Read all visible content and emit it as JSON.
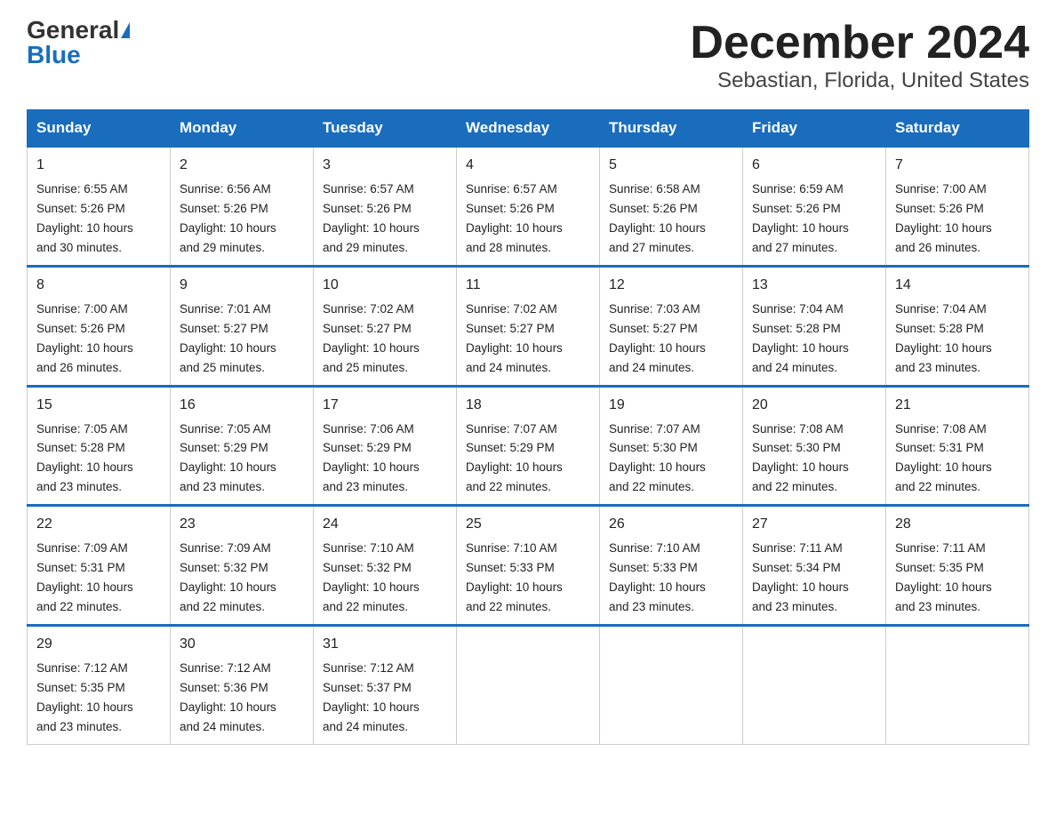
{
  "logo": {
    "general": "General",
    "blue": "Blue"
  },
  "title": "December 2024",
  "subtitle": "Sebastian, Florida, United States",
  "days_of_week": [
    "Sunday",
    "Monday",
    "Tuesday",
    "Wednesday",
    "Thursday",
    "Friday",
    "Saturday"
  ],
  "weeks": [
    [
      {
        "num": "1",
        "sunrise": "6:55 AM",
        "sunset": "5:26 PM",
        "daylight": "10 hours and 30 minutes."
      },
      {
        "num": "2",
        "sunrise": "6:56 AM",
        "sunset": "5:26 PM",
        "daylight": "10 hours and 29 minutes."
      },
      {
        "num": "3",
        "sunrise": "6:57 AM",
        "sunset": "5:26 PM",
        "daylight": "10 hours and 29 minutes."
      },
      {
        "num": "4",
        "sunrise": "6:57 AM",
        "sunset": "5:26 PM",
        "daylight": "10 hours and 28 minutes."
      },
      {
        "num": "5",
        "sunrise": "6:58 AM",
        "sunset": "5:26 PM",
        "daylight": "10 hours and 27 minutes."
      },
      {
        "num": "6",
        "sunrise": "6:59 AM",
        "sunset": "5:26 PM",
        "daylight": "10 hours and 27 minutes."
      },
      {
        "num": "7",
        "sunrise": "7:00 AM",
        "sunset": "5:26 PM",
        "daylight": "10 hours and 26 minutes."
      }
    ],
    [
      {
        "num": "8",
        "sunrise": "7:00 AM",
        "sunset": "5:26 PM",
        "daylight": "10 hours and 26 minutes."
      },
      {
        "num": "9",
        "sunrise": "7:01 AM",
        "sunset": "5:27 PM",
        "daylight": "10 hours and 25 minutes."
      },
      {
        "num": "10",
        "sunrise": "7:02 AM",
        "sunset": "5:27 PM",
        "daylight": "10 hours and 25 minutes."
      },
      {
        "num": "11",
        "sunrise": "7:02 AM",
        "sunset": "5:27 PM",
        "daylight": "10 hours and 24 minutes."
      },
      {
        "num": "12",
        "sunrise": "7:03 AM",
        "sunset": "5:27 PM",
        "daylight": "10 hours and 24 minutes."
      },
      {
        "num": "13",
        "sunrise": "7:04 AM",
        "sunset": "5:28 PM",
        "daylight": "10 hours and 24 minutes."
      },
      {
        "num": "14",
        "sunrise": "7:04 AM",
        "sunset": "5:28 PM",
        "daylight": "10 hours and 23 minutes."
      }
    ],
    [
      {
        "num": "15",
        "sunrise": "7:05 AM",
        "sunset": "5:28 PM",
        "daylight": "10 hours and 23 minutes."
      },
      {
        "num": "16",
        "sunrise": "7:05 AM",
        "sunset": "5:29 PM",
        "daylight": "10 hours and 23 minutes."
      },
      {
        "num": "17",
        "sunrise": "7:06 AM",
        "sunset": "5:29 PM",
        "daylight": "10 hours and 23 minutes."
      },
      {
        "num": "18",
        "sunrise": "7:07 AM",
        "sunset": "5:29 PM",
        "daylight": "10 hours and 22 minutes."
      },
      {
        "num": "19",
        "sunrise": "7:07 AM",
        "sunset": "5:30 PM",
        "daylight": "10 hours and 22 minutes."
      },
      {
        "num": "20",
        "sunrise": "7:08 AM",
        "sunset": "5:30 PM",
        "daylight": "10 hours and 22 minutes."
      },
      {
        "num": "21",
        "sunrise": "7:08 AM",
        "sunset": "5:31 PM",
        "daylight": "10 hours and 22 minutes."
      }
    ],
    [
      {
        "num": "22",
        "sunrise": "7:09 AM",
        "sunset": "5:31 PM",
        "daylight": "10 hours and 22 minutes."
      },
      {
        "num": "23",
        "sunrise": "7:09 AM",
        "sunset": "5:32 PM",
        "daylight": "10 hours and 22 minutes."
      },
      {
        "num": "24",
        "sunrise": "7:10 AM",
        "sunset": "5:32 PM",
        "daylight": "10 hours and 22 minutes."
      },
      {
        "num": "25",
        "sunrise": "7:10 AM",
        "sunset": "5:33 PM",
        "daylight": "10 hours and 22 minutes."
      },
      {
        "num": "26",
        "sunrise": "7:10 AM",
        "sunset": "5:33 PM",
        "daylight": "10 hours and 23 minutes."
      },
      {
        "num": "27",
        "sunrise": "7:11 AM",
        "sunset": "5:34 PM",
        "daylight": "10 hours and 23 minutes."
      },
      {
        "num": "28",
        "sunrise": "7:11 AM",
        "sunset": "5:35 PM",
        "daylight": "10 hours and 23 minutes."
      }
    ],
    [
      {
        "num": "29",
        "sunrise": "7:12 AM",
        "sunset": "5:35 PM",
        "daylight": "10 hours and 23 minutes."
      },
      {
        "num": "30",
        "sunrise": "7:12 AM",
        "sunset": "5:36 PM",
        "daylight": "10 hours and 24 minutes."
      },
      {
        "num": "31",
        "sunrise": "7:12 AM",
        "sunset": "5:37 PM",
        "daylight": "10 hours and 24 minutes."
      },
      null,
      null,
      null,
      null
    ]
  ],
  "labels": {
    "sunrise": "Sunrise:",
    "sunset": "Sunset:",
    "daylight": "Daylight:"
  }
}
